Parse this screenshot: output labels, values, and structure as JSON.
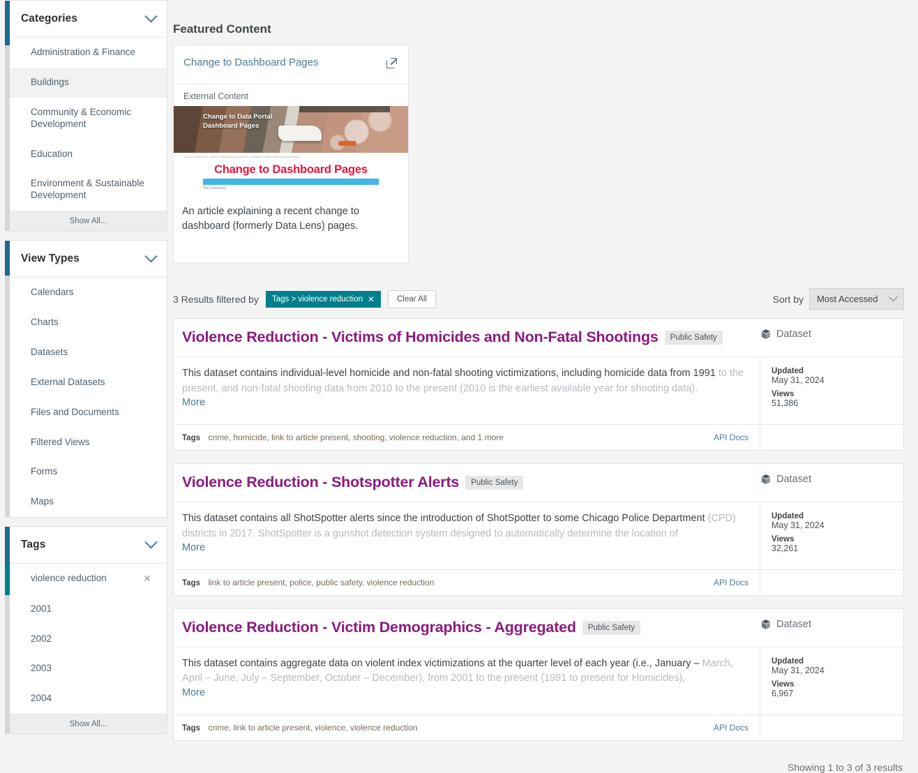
{
  "sidebar": {
    "facets": [
      {
        "title": "Categories",
        "chevron_icon": "chevron-down-icon",
        "items": [
          {
            "label": "Administration & Finance"
          },
          {
            "label": "Buildings"
          },
          {
            "label": "Community & Economic Development"
          },
          {
            "label": "Education"
          },
          {
            "label": "Environment & Sustainable Development"
          }
        ],
        "show_all": "Show All..."
      },
      {
        "title": "View Types",
        "chevron_icon": "chevron-down-icon",
        "items": [
          {
            "label": "Calendars"
          },
          {
            "label": "Charts"
          },
          {
            "label": "Datasets"
          },
          {
            "label": "External Datasets"
          },
          {
            "label": "Files and Documents"
          },
          {
            "label": "Filtered Views"
          },
          {
            "label": "Forms"
          },
          {
            "label": "Maps"
          }
        ],
        "show_all": ""
      },
      {
        "title": "Tags",
        "chevron_icon": "chevron-down-icon",
        "items": [
          {
            "label": "violence reduction",
            "remove_icon": "close-icon",
            "remove_glyph": "✕"
          },
          {
            "label": "2001"
          },
          {
            "label": "2002"
          },
          {
            "label": "2003"
          },
          {
            "label": "2004"
          }
        ],
        "show_all": "Show All..."
      }
    ]
  },
  "featured": {
    "section_title": "Featured Content",
    "link_title": "Change to Dashboard Pages",
    "external_icon": "external-link-icon",
    "content_type": "External Content",
    "thumbnail": {
      "overlay_title": "Change to Data Portal Dashboard Pages",
      "breadcrumb": "Home / Departments / Assets, Information and Services / Change to Data Portal Dashboard Pages",
      "headline": "Change to Dashboard Pages",
      "subhead": "The Summary"
    },
    "description": "An article explaining a recent change to dashboard (formerly Data Lens) pages."
  },
  "results_bar": {
    "count_text": "3 Results filtered by",
    "chip_label": "Tags > violence reduction",
    "chip_remove_glyph": "✕",
    "clear_all": "Clear All",
    "sort_label": "Sort by",
    "sort_value": "Most Accessed",
    "sort_chevron_icon": "chevron-down-icon"
  },
  "results": [
    {
      "title": "Violence Reduction - Victims of Homicides and Non-Fatal Shootings",
      "category": "Public Safety",
      "type_label": "Dataset",
      "type_icon": "dataset-icon",
      "desc_visible": "This dataset contains individual-level homicide and non-fatal shooting victimizations, including homicide data from 1991",
      "desc_faded": "to the present, and non-fatal shooting data from 2010 to the present (2010 is the earliest available year for shooting data).",
      "more_label": "More",
      "updated_key": "Updated",
      "updated_value": "May 31, 2024",
      "views_key": "Views",
      "views_value": "51,386",
      "tags_key": "Tags",
      "tags_value": "crime, homicide, link to article present, shooting, violence reduction, and 1 more",
      "api_docs": "API Docs"
    },
    {
      "title": "Violence Reduction - Shotspotter Alerts",
      "category": "Public Safety",
      "type_label": "Dataset",
      "type_icon": "dataset-icon",
      "desc_visible": "This dataset contains all ShotSpotter alerts since the introduction of ShotSpotter to some Chicago Police Department",
      "desc_faded": "(CPD) districts in 2017. ShotSpotter is a gunshot detection system designed to automatically determine the location of",
      "more_label": "More",
      "updated_key": "Updated",
      "updated_value": "May 31, 2024",
      "views_key": "Views",
      "views_value": "32,261",
      "tags_key": "Tags",
      "tags_value": "link to article present, police, public safety, violence reduction",
      "api_docs": "API Docs"
    },
    {
      "title": "Violence Reduction - Victim Demographics - Aggregated",
      "category": "Public Safety",
      "type_label": "Dataset",
      "type_icon": "dataset-icon",
      "desc_visible": "This dataset contains aggregate data on violent index victimizations at the quarter level of each year (i.e., January –",
      "desc_faded": "March, April – June, July – September, October – December), from 2001 to the present (1991 to present for Homicides),",
      "more_label": "More",
      "updated_key": "Updated",
      "updated_value": "May 31, 2024",
      "views_key": "Views",
      "views_value": "6,967",
      "tags_key": "Tags",
      "tags_value": "crime, link to article present, violence, violence reduction",
      "api_docs": "API Docs"
    }
  ],
  "footer": {
    "showing": "Showing 1 to 3 of 3 results"
  },
  "colors": {
    "accent_blue": "#1a6a95",
    "accent_teal": "#00808d",
    "title_purple": "#8b1a7f",
    "link_blue": "#4c7c98",
    "headline_red": "#e8173d",
    "rule_cyan": "#41b6e6"
  }
}
